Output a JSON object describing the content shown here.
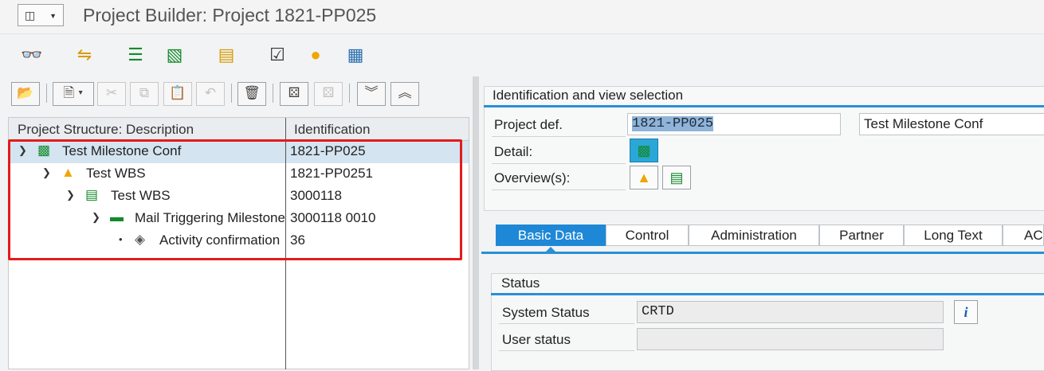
{
  "app": {
    "title": "Project Builder: Project 1821-PP025"
  },
  "toolbar": {
    "icons": [
      "glasses-icon",
      "arrows-exchange-icon",
      "structure-list-icon",
      "hierarchy-icon",
      "gantt-icon",
      "document-check-icon",
      "coin-icon",
      "network-icon"
    ]
  },
  "tree": {
    "col_description": "Project Structure: Description",
    "col_identification": "Identification",
    "rows": [
      {
        "label": "Test Milestone Conf",
        "id": "1821-PP025",
        "icon": "project-definition-icon"
      },
      {
        "label": "Test WBS",
        "id": "1821-PP0251",
        "icon": "wbs-triangle-icon"
      },
      {
        "label": "Test WBS",
        "id": "3000118",
        "icon": "network-header-icon"
      },
      {
        "label": "Mail Triggering Milestone",
        "id": "3000118 0010",
        "icon": "activity-icon"
      },
      {
        "label": "Activity confirmation",
        "id": "36",
        "icon": "milestone-diamond-icon"
      }
    ]
  },
  "identification": {
    "title": "Identification and view selection",
    "project_def_label": "Project def.",
    "project_def_value": "1821-PP025",
    "project_desc_value": "Test Milestone Conf",
    "detail_label": "Detail:",
    "overview_label": "Overview(s):"
  },
  "tabs": [
    "Basic Data",
    "Control",
    "Administration",
    "Partner",
    "Long Text",
    "ACI"
  ],
  "status": {
    "title": "Status",
    "system_status_label": "System Status",
    "system_status_value": "CRTD",
    "user_status_label": "User status",
    "user_status_value": "",
    "info_button": "i"
  },
  "colors": {
    "accent": "#1e88d6",
    "highlight": "#e41b1b",
    "selection": "#d4e4f0"
  }
}
